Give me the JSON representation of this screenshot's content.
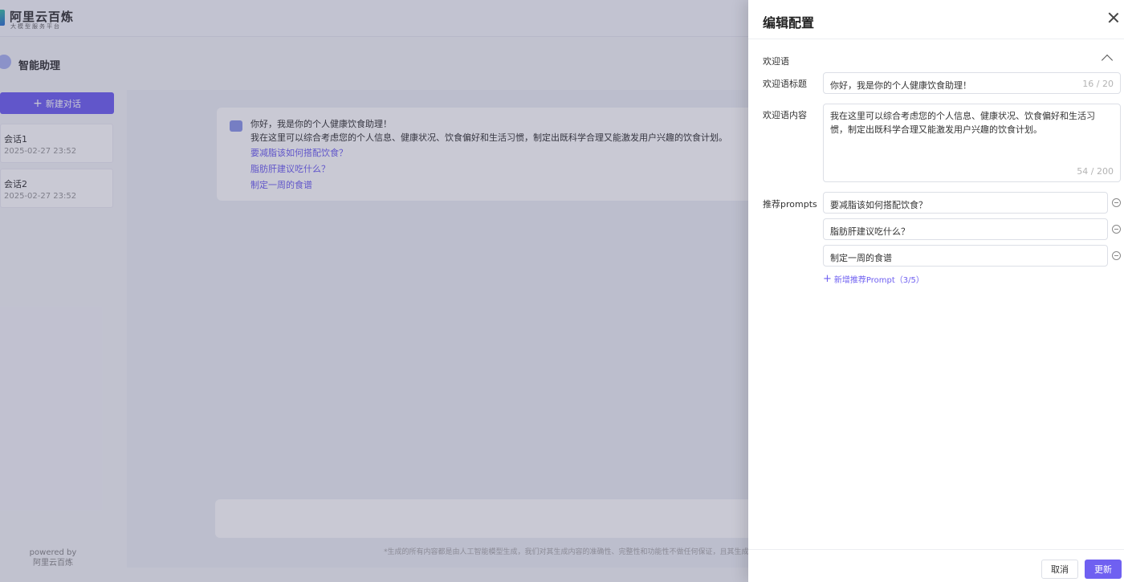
{
  "brand": {
    "title": "阿里云百炼",
    "subtitle": "大模型服务平台"
  },
  "assistant": {
    "title": "智能助理"
  },
  "sidebar": {
    "new_chat_label": "新建对话",
    "sessions": [
      {
        "title": "会话1",
        "time": "2025-02-27 23:52"
      },
      {
        "title": "会话2",
        "time": "2025-02-27 23:52"
      }
    ],
    "powered_by": "powered by",
    "powered_name": "阿里云百炼"
  },
  "welcome_card": {
    "title": "你好，我是你的个人健康饮食助理！",
    "body": "我在这里可以综合考虑您的个人信息、健康状况、饮食偏好和生活习惯，制定出既科学合理又能激发用户兴趣的饮食计划。",
    "links": [
      "要减脂该如何搭配饮食？",
      "脂肪肝建议吃什么？",
      "制定一周的食谱"
    ]
  },
  "disclaimer": "*生成的所有内容都是由人工智能模型生成，我们对其生成内容的准确性、完整性和功能性不做任何保证，且其生成",
  "drawer": {
    "title": "编辑配置",
    "section_label": "欢迎语",
    "welcome_title_label": "欢迎语标题",
    "welcome_title_value": "你好，我是你的个人健康饮食助理！",
    "welcome_title_counter": "16 / 20",
    "welcome_content_label": "欢迎语内容",
    "welcome_content_value": "我在这里可以综合考虑您的个人信息、健康状况、饮食偏好和生活习惯，制定出既科学合理又能激发用户兴趣的饮食计划。",
    "welcome_content_counter": "54 / 200",
    "prompts_label": "推荐prompts",
    "prompts": [
      "要减脂该如何搭配饮食？",
      "脂肪肝建议吃什么？",
      "制定一周的食谱"
    ],
    "add_prompt_label": "新增推荐Prompt（3/5）",
    "cancel_label": "取消",
    "update_label": "更新"
  },
  "colors": {
    "accent": "#6f60f1"
  }
}
